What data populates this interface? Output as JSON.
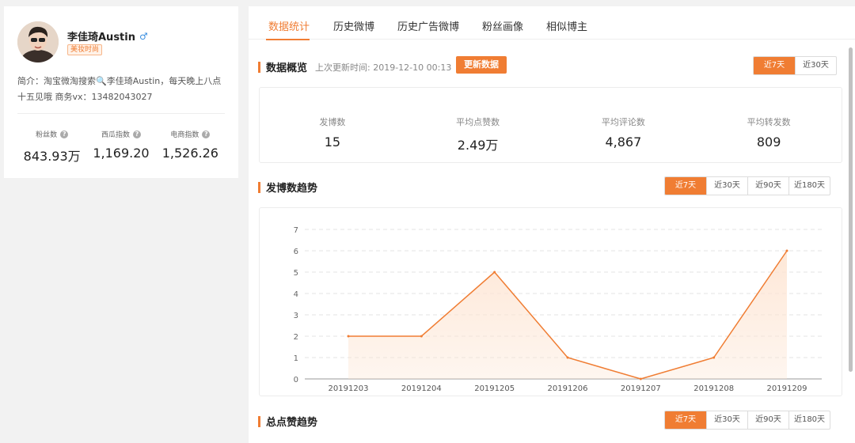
{
  "profile": {
    "name": "李佳琦Austin",
    "gender_symbol": "♂",
    "tag": "美妆时尚",
    "bio_line1": "简介：淘宝微淘搜索🔍李佳琦Austin，每天晚上八点",
    "bio_line2": "十五见哦 商务vx：13482043027",
    "stats": [
      {
        "label": "粉丝数",
        "value": "843.93万"
      },
      {
        "label": "西瓜指数",
        "value": "1,169.20"
      },
      {
        "label": "电商指数",
        "value": "1,526.26"
      }
    ]
  },
  "tabs": [
    "数据统计",
    "历史微博",
    "历史广告微博",
    "粉丝画像",
    "相似博主"
  ],
  "overview_section": {
    "title": "数据概览",
    "updated": "上次更新时间: 2019-12-10 00:13",
    "refresh_label": "更新数据",
    "range_options": [
      "近7天",
      "近30天"
    ],
    "metrics": [
      {
        "label": "发博数",
        "value": "15"
      },
      {
        "label": "平均点赞数",
        "value": "2.49万"
      },
      {
        "label": "平均评论数",
        "value": "4,867"
      },
      {
        "label": "平均转发数",
        "value": "809"
      }
    ]
  },
  "post_trend_section": {
    "title": "发博数趋势",
    "range_options": [
      "近7天",
      "近30天",
      "近90天",
      "近180天"
    ]
  },
  "like_trend_section": {
    "title": "总点赞趋势",
    "range_options": [
      "近7天",
      "近30天",
      "近90天",
      "近180天"
    ]
  },
  "colors": {
    "accent": "#f07d33",
    "area_fill": "#fde5d3"
  },
  "chart_data": {
    "type": "area",
    "x": [
      "20191203",
      "20191204",
      "20191205",
      "20191206",
      "20191207",
      "20191208",
      "20191209"
    ],
    "series": [
      {
        "values": [
          2,
          2,
          5,
          1,
          0,
          1,
          6
        ]
      }
    ],
    "ylim": [
      0,
      7
    ],
    "yticks": [
      0,
      1,
      2,
      3,
      4,
      5,
      6,
      7
    ],
    "grid": true
  }
}
